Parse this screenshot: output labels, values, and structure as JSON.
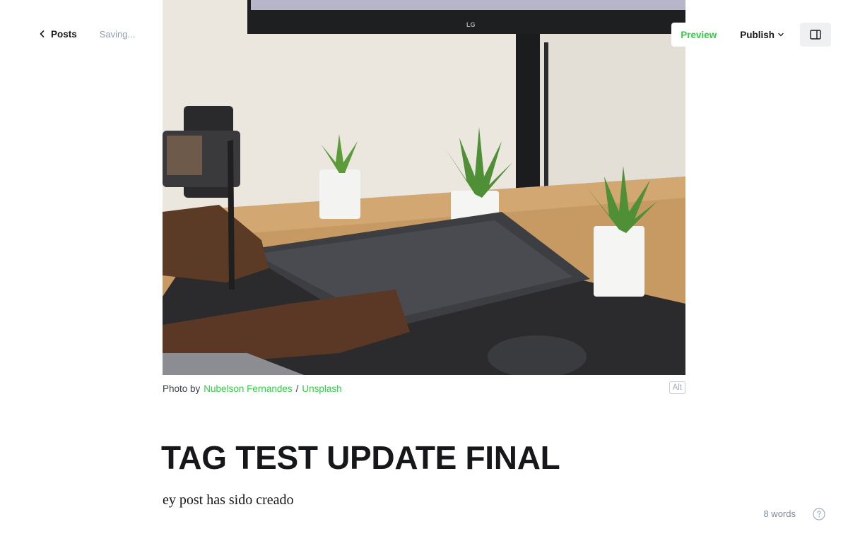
{
  "header": {
    "back_label": "Posts",
    "status": "Saving...",
    "preview_label": "Preview",
    "publish_label": "Publish"
  },
  "feature_image": {
    "monitor_brand": "LG",
    "caption_prefix": "Photo by",
    "author": "Nubelson Fernandes",
    "separator": "/",
    "source": "Unsplash",
    "alt_label": "Alt"
  },
  "post": {
    "title": "TAG TEST UPDATE FINAL",
    "body": "ey post has sido creado"
  },
  "footer": {
    "word_count": "8 words"
  },
  "colors": {
    "accent": "#30cf43",
    "text": "#15171a",
    "muted": "#8e9cac"
  }
}
